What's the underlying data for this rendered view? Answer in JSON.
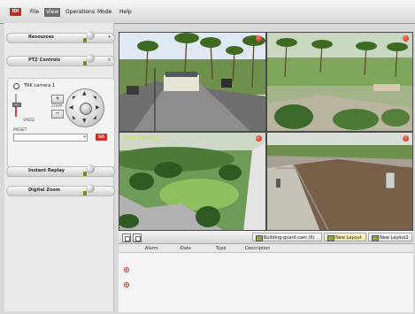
{
  "menubar": {
    "logo_text": "IDI",
    "items": [
      "File",
      "View",
      "Operations",
      "Mode",
      "Help"
    ],
    "active_item": "View"
  },
  "left_panel": {
    "resources_label": "Resources",
    "ptz_label": "PTZ Controls",
    "camera_name": "TRK camera 1",
    "speed_label": "SPEED",
    "speed_level_fraction": 0.55,
    "zoom_label": "ZOOM",
    "zoom_in": "+",
    "zoom_out": "−",
    "preset_label": "PRESET",
    "preset_value": "",
    "go_label": "GO",
    "advanced_label": "Advanced Properties",
    "instant_replay_label": "Instant Replay",
    "digital_zoom_label": "Digital Zoom"
  },
  "video": {
    "tiles": [
      {
        "caption": "",
        "recording": true
      },
      {
        "caption": "",
        "recording": true
      },
      {
        "caption": "Main Building",
        "recording": true
      },
      {
        "caption": "",
        "recording": true
      }
    ]
  },
  "layout_tabs": [
    {
      "label": "Building-guard cam (6)",
      "active": false
    },
    {
      "label": "New Layout",
      "active": true
    },
    {
      "label": "New Layout2",
      "active": false
    }
  ],
  "alarm_table": {
    "columns": [
      "Alarm",
      "Date",
      "Type",
      "Description"
    ],
    "rows": 2
  },
  "colors": {
    "accent_red": "#c93227",
    "caption_yellow": "#cfe640",
    "menu_active": "#6d6d6d"
  }
}
